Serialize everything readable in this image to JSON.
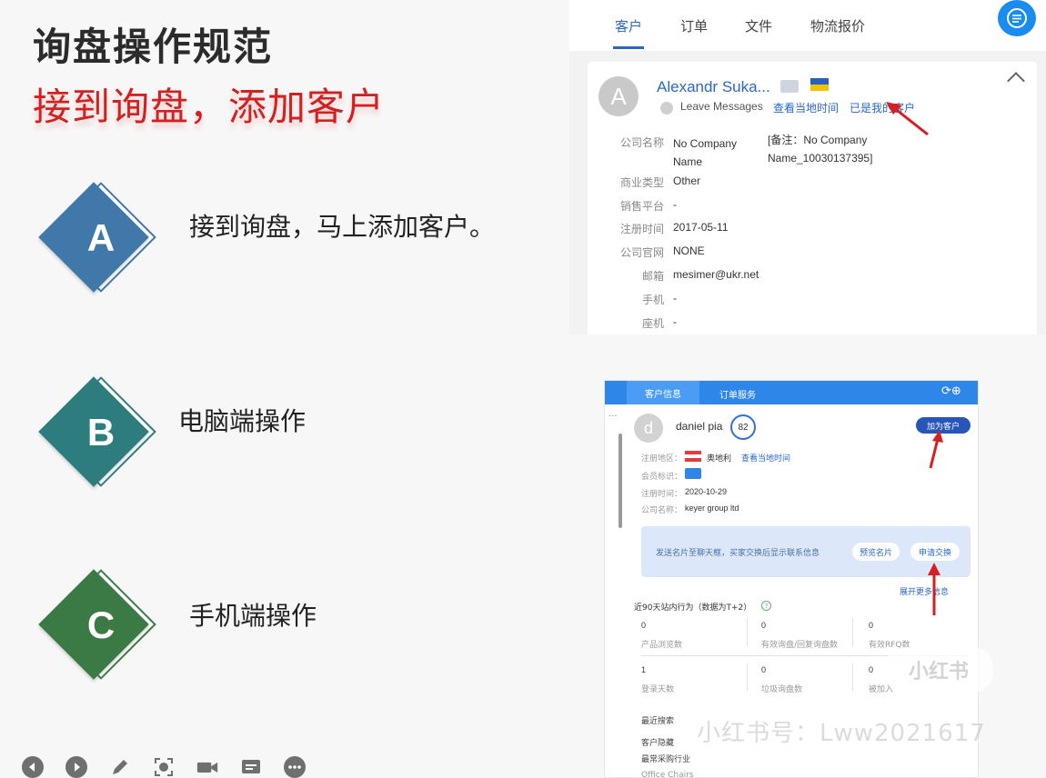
{
  "slide": {
    "title": "询盘操作规范",
    "subtitle": "接到询盘，添加客户",
    "steps": [
      {
        "letter": "A",
        "text": "接到询盘，马上添加客户。",
        "color": "#3f78a9",
        "outline": "#3f78a9"
      },
      {
        "letter": "B",
        "text": "电脑端操作",
        "color": "#2d7d7e",
        "outline": "#2d7d7e"
      },
      {
        "letter": "C",
        "text": "手机端操作",
        "color": "#3c7a45",
        "outline": "#3c7a45"
      }
    ]
  },
  "top_panel": {
    "tabs": [
      "客户",
      "订单",
      "文件",
      "物流报价"
    ],
    "active_tab": "客户",
    "customer": {
      "avatar_letter": "A",
      "name": "Alexandr Suka...",
      "leave_messages": "Leave Messages",
      "local_time_link": "查看当地时间",
      "my_customer_link": "已是我的客户"
    },
    "fields": [
      {
        "label": "公司名称",
        "value": "No Company Name",
        "note": "[备注：No Company Name_10030137395]"
      },
      {
        "label": "商业类型",
        "value": "Other"
      },
      {
        "label": "销售平台",
        "value": "-"
      },
      {
        "label": "注册时间",
        "value": "2017-05-11"
      },
      {
        "label": "公司官网",
        "value": "NONE"
      },
      {
        "label": "邮箱",
        "value": "mesimer@ukr.net"
      },
      {
        "label": "手机",
        "value": "-"
      },
      {
        "label": "座机",
        "value": "-"
      }
    ]
  },
  "bottom_panel": {
    "tabs": [
      "客户信息",
      "订单服务"
    ],
    "header_icons": "⟳⊕",
    "dots": "···",
    "avatar_letter": "d",
    "name": "daniel pia",
    "score": "82",
    "add_button": "加为客户",
    "region_label": "注册地区：",
    "region_value": "奥地利",
    "region_link": "查看当地时间",
    "member_label": "会员标识：",
    "reg_time_label": "注册时间：",
    "reg_time_value": "2020-10-29",
    "company_label": "公司名称：",
    "company_value": "keyer group ltd",
    "card_text": "发送名片至聊天框，买家交换后显示联系信息",
    "preview_button": "预览名片",
    "apply_button": "申请交换",
    "expand_link": "展开更多信息",
    "activity_title": "近90天站内行为（数据为T+2）",
    "stats_row1": [
      {
        "num": "0",
        "label": "产品浏览数"
      },
      {
        "num": "0",
        "label": "有效询盘/回复询盘数"
      },
      {
        "num": "0",
        "label": "有效RFQ数"
      }
    ],
    "stats_row2": [
      {
        "num": "1",
        "label": "登录天数"
      },
      {
        "num": "0",
        "label": "垃圾询盘数"
      },
      {
        "num": "0",
        "label": "被加入"
      }
    ],
    "recent_search": "最近搜索",
    "customer_hidden": "客户隐藏",
    "frequent_industry": "最常采购行业",
    "industry_value": "Office Chairs"
  },
  "watermark": {
    "text": "小红书号：Lww2021617",
    "logo": "小红书"
  },
  "toolbar": {
    "icons": [
      "prev-icon",
      "next-icon",
      "pen-icon",
      "focus-icon",
      "camera-icon",
      "subtitle-icon",
      "more-icon"
    ]
  }
}
